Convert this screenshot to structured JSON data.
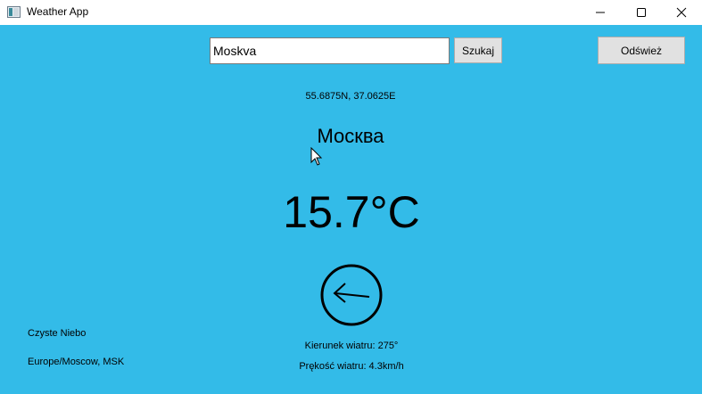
{
  "window": {
    "title": "Weather App"
  },
  "search": {
    "value": "Moskva",
    "button_label": "Szukaj"
  },
  "toolbar": {
    "refresh_label": "Odśwież"
  },
  "location": {
    "coordinates": "55.6875N, 37.0625E",
    "city_name": "Москва",
    "timezone": "Europe/Moscow, MSK"
  },
  "weather": {
    "temperature": "15.7°C",
    "condition": "Czyste Niebo",
    "wind_direction": "Kierunek wiatru: 275°",
    "wind_speed": "Prękość wiatru: 4.3km/h",
    "wind_icon": "arrow-left-circle-icon"
  },
  "colors": {
    "background": "#33bbe8",
    "button": "#e1e1e1"
  }
}
